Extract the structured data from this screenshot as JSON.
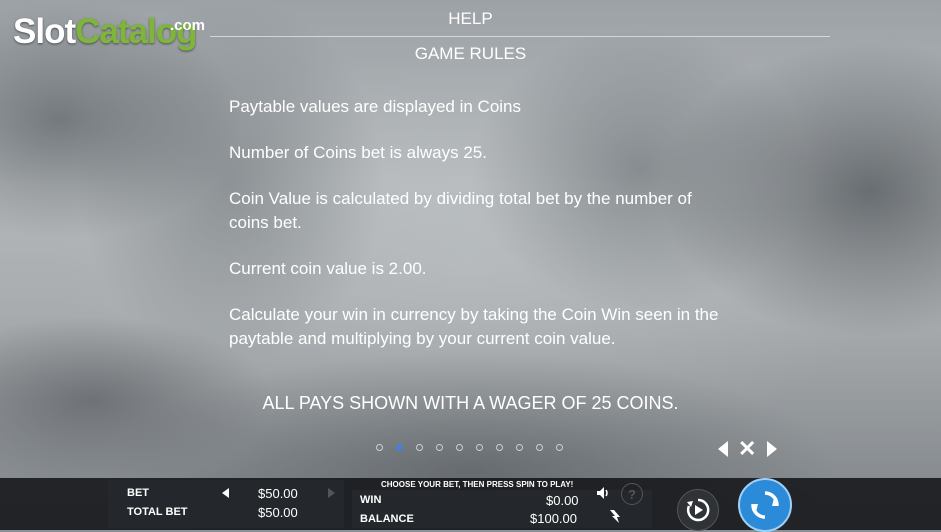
{
  "logo": {
    "slot": "Slot",
    "catalog": "Catalog",
    "com": ".com"
  },
  "header": {
    "title": "HELP",
    "section": "GAME RULES"
  },
  "rules": [
    "Paytable values are displayed in Coins",
    "Number of Coins bet is always 25.",
    "Coin Value is calculated by dividing total bet by the number of coins bet.",
    "Current coin value is 2.00.",
    "Calculate your win in currency by taking the Coin Win seen in the paytable and multiplying by your current coin value."
  ],
  "wager_note": "ALL PAYS SHOWN WITH A WAGER OF 25 COINS.",
  "pagination": {
    "total": 10,
    "active_index": 1
  },
  "bottom_bar": {
    "bet_label": "BET",
    "bet_value": "$50.00",
    "total_bet_label": "TOTAL BET",
    "total_bet_value": "$50.00",
    "notice": "CHOOSE YOUR BET, THEN PRESS SPIN TO PLAY!",
    "win_label": "WIN",
    "win_value": "$0.00",
    "balance_label": "BALANCE",
    "balance_value": "$100.00",
    "help_glyph": "?"
  },
  "icons": {
    "prev": "arrow-left-icon",
    "close": "close-icon",
    "next": "arrow-right-icon",
    "sound": "speaker-icon",
    "help": "question-icon",
    "turbo": "lightning-icon",
    "autoplay": "autoplay-icon",
    "spin": "spin-icon"
  },
  "colors": {
    "active_dot": "#4b7fd6",
    "spin_button": "#2b8bd8",
    "logo_green": "#7fb63a"
  }
}
